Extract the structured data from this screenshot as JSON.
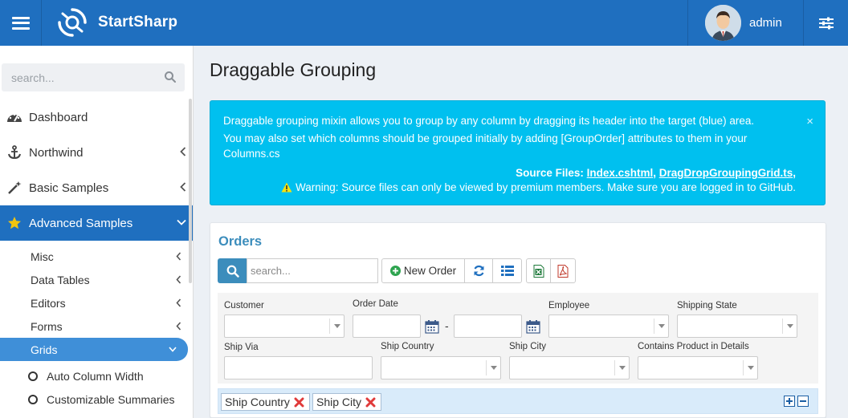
{
  "app": {
    "brand": "StartSharp",
    "user": "admin"
  },
  "sidebar": {
    "search_placeholder": "search...",
    "items": [
      {
        "label": "Dashboard",
        "icon": "dashboard-icon"
      },
      {
        "label": "Northwind",
        "icon": "anchor-icon"
      },
      {
        "label": "Basic Samples",
        "icon": "magic-wand-icon"
      },
      {
        "label": "Advanced Samples",
        "icon": "star-icon"
      }
    ],
    "subitems": [
      "Misc",
      "Data Tables",
      "Editors",
      "Forms",
      "Grids"
    ],
    "leaves": [
      "Auto Column Width",
      "Customizable Summaries"
    ]
  },
  "page": {
    "title": "Draggable Grouping"
  },
  "callout": {
    "line1": "Draggable grouping mixin allows you to group by any column by dragging its header into the target (blue) area.",
    "line2": "You may also set which columns should be grouped initially by adding [GroupOrder] attributes to them in your",
    "line3": "Columns.cs",
    "source_label": "Source Files:",
    "file1": "Index.cshtml",
    "sep": ",",
    "file2": "DragDropGroupingGrid.ts",
    "sep2": ",",
    "warning": "Warning: Source files can only be viewed by premium members. Make sure you are logged in to GitHub.",
    "close": "×"
  },
  "grid": {
    "title": "Orders",
    "search_placeholder": "search...",
    "new_button": "New Order",
    "filters": {
      "customer": "Customer",
      "order_date": "Order Date",
      "date_sep": "-",
      "employee": "Employee",
      "shipping_state": "Shipping State",
      "ship_via": "Ship Via",
      "ship_country": "Ship Country",
      "ship_city": "Ship City",
      "contains_product": "Contains Product in Details"
    },
    "groups": [
      "Ship Country",
      "Ship City"
    ]
  },
  "colors": {
    "topbar": "#1f6fbf",
    "callout": "#00c0ef",
    "accent": "#3c8dbc",
    "group_area": "#d9ebfa"
  }
}
